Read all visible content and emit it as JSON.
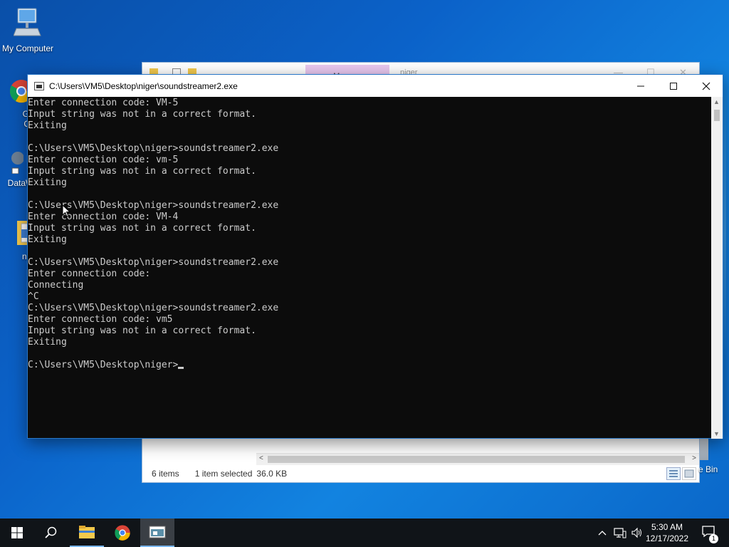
{
  "desktop": {
    "icons": [
      {
        "label": "My Computer",
        "icon": "monitor-icon"
      },
      {
        "label": "Goo Chr",
        "icon": "chrome-icon"
      },
      {
        "label": "DataW",
        "icon": "app-icon"
      },
      {
        "label": "nig",
        "icon": "folder-icon"
      },
      {
        "label": "e Bin",
        "icon": "recycle-bin-icon"
      }
    ]
  },
  "explorer": {
    "manage_tab": "Manage",
    "path_fragment": "niger",
    "status": {
      "items": "6 items",
      "selected": "1 item selected",
      "size": "36.0 KB"
    }
  },
  "console": {
    "title": "C:\\Users\\VM5\\Desktop\\niger\\soundstreamer2.exe",
    "lines": [
      "Enter connection code: VM-5",
      "Input string was not in a correct format.",
      "Exiting",
      "",
      "C:\\Users\\VM5\\Desktop\\niger>soundstreamer2.exe",
      "Enter connection code: vm-5",
      "Input string was not in a correct format.",
      "Exiting",
      "",
      "C:\\Users\\VM5\\Desktop\\niger>soundstreamer2.exe",
      "Enter connection code: VM-4",
      "Input string was not in a correct format.",
      "Exiting",
      "",
      "C:\\Users\\VM5\\Desktop\\niger>soundstreamer2.exe",
      "Enter connection code:",
      "Connecting",
      "^C",
      "C:\\Users\\VM5\\Desktop\\niger>soundstreamer2.exe",
      "Enter connection code: vm5",
      "Input string was not in a correct format.",
      "Exiting",
      "",
      "C:\\Users\\VM5\\Desktop\\niger>"
    ]
  },
  "taskbar": {
    "items": [
      "start-icon",
      "search-icon",
      "file-explorer-icon",
      "chrome-icon",
      "console-icon"
    ],
    "clock": {
      "time": "5:30 AM",
      "date": "12/17/2022"
    },
    "notification_count": "1"
  }
}
